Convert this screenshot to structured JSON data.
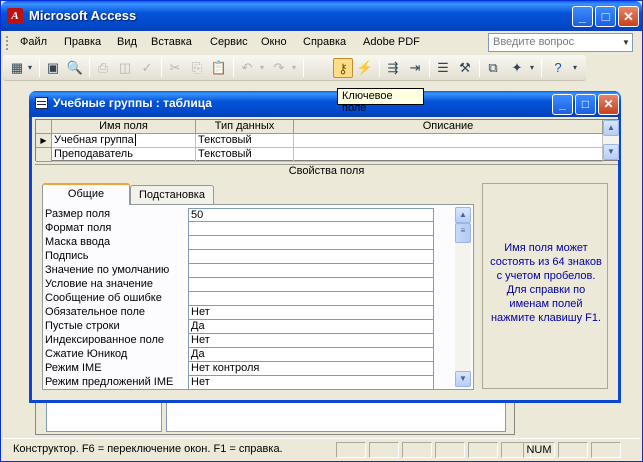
{
  "app": {
    "title": "Microsoft Access",
    "logo_glyph": "A"
  },
  "menu": {
    "items": [
      "Файл",
      "Правка",
      "Вид",
      "Вставка",
      "Сервис",
      "Окно",
      "Справка",
      "Adobe PDF"
    ],
    "help_placeholder": "Введите вопрос"
  },
  "toolbar": {
    "tooltip": "Ключевое поле",
    "icons": [
      "view-icon",
      "save-icon",
      "search-file-icon",
      "print-icon",
      "print-preview-icon",
      "spelling-icon",
      "cut-icon",
      "copy-icon",
      "paste-icon",
      "undo-icon",
      "redo-icon",
      "primary-key-icon",
      "indexes-icon",
      "insert-rows-icon",
      "delete-rows-icon",
      "properties-icon",
      "build-icon",
      "database-window-icon",
      "new-object-icon",
      "help-icon"
    ]
  },
  "window": {
    "title": "Учебные группы : таблица",
    "columns": [
      "Имя поля",
      "Тип данных",
      "Описание"
    ],
    "rows": [
      {
        "name": "Учебная группа",
        "type": "Текстовый",
        "desc": ""
      },
      {
        "name": "Преподаватель",
        "type": "Текстовый",
        "desc": ""
      }
    ],
    "properties_label": "Свойства поля",
    "tabs": [
      "Общие",
      "Подстановка"
    ],
    "properties": [
      {
        "label": "Размер поля",
        "value": "50"
      },
      {
        "label": "Формат поля",
        "value": ""
      },
      {
        "label": "Маска ввода",
        "value": ""
      },
      {
        "label": "Подпись",
        "value": ""
      },
      {
        "label": "Значение по умолчанию",
        "value": ""
      },
      {
        "label": "Условие на значение",
        "value": ""
      },
      {
        "label": "Сообщение об ошибке",
        "value": ""
      },
      {
        "label": "Обязательное поле",
        "value": "Нет"
      },
      {
        "label": "Пустые строки",
        "value": "Да"
      },
      {
        "label": "Индексированное поле",
        "value": "Нет"
      },
      {
        "label": "Сжатие Юникод",
        "value": "Да"
      },
      {
        "label": "Режим IME",
        "value": "Нет контроля"
      },
      {
        "label": "Режим предложений IME",
        "value": "Нет"
      }
    ],
    "help_text": "Имя поля может состоять из 64 знаков с учетом пробелов. Для справки по именам полей нажмите клавишу F1."
  },
  "status": {
    "text": "Конструктор.  F6 = переключение окон.  F1 = справка.",
    "num": "NUM"
  },
  "colors": {
    "titlebar": "#0553d9",
    "close": "#c7411c",
    "tooltip_bg": "#ffffe1",
    "help_text": "#0000a0",
    "active_tab_accent": "#f2a43b"
  }
}
